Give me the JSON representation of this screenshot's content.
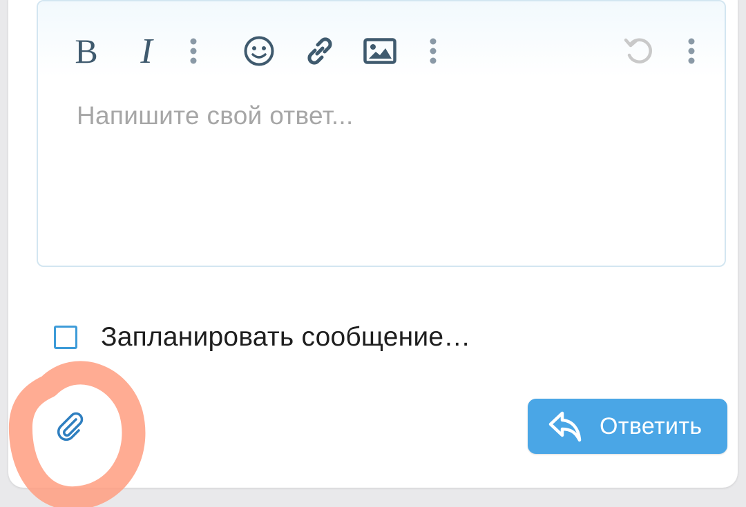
{
  "toolbar": {
    "items": [
      {
        "name": "bold-icon",
        "glyph": "B"
      },
      {
        "name": "italic-icon",
        "glyph": "I"
      },
      {
        "name": "more-text-options-icon"
      },
      {
        "name": "emoji-icon"
      },
      {
        "name": "link-icon"
      },
      {
        "name": "image-icon"
      },
      {
        "name": "more-insert-options-icon"
      },
      {
        "name": "undo-icon"
      },
      {
        "name": "more-options-icon"
      }
    ],
    "icon_color": "#3f5a6e",
    "disabled_color": "#c9c9c9"
  },
  "editor": {
    "placeholder": "Напишите свой ответ..."
  },
  "schedule": {
    "label": "Запланировать сообщение…",
    "checked": false,
    "checkbox_color": "#3d9bd8"
  },
  "attach": {
    "icon": "paperclip-icon",
    "color": "#2f7fc0"
  },
  "reply_button": {
    "label": "Ответить",
    "icon": "reply-icon",
    "color": "#4aa6e6"
  },
  "annotation": {
    "shape": "hand-drawn circle",
    "color": "#ff9e80"
  }
}
